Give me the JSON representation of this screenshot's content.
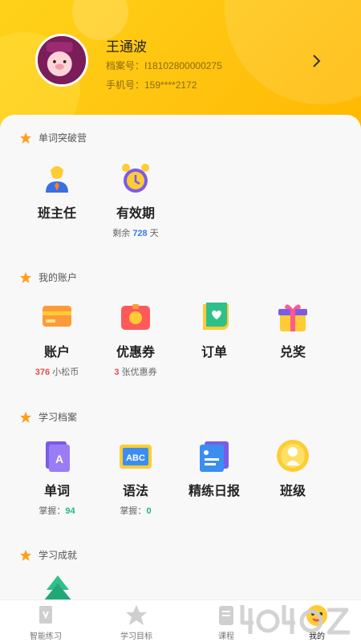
{
  "profile": {
    "name": "王通波",
    "archive_line": "档案号：I18102800000275",
    "phone_line": "手机号：159****2172"
  },
  "sections": {
    "camp": {
      "title": "单词突破营",
      "items": [
        {
          "label": "班主任"
        },
        {
          "label": "有效期",
          "sub_prefix": "剩余 ",
          "sub_value": "728",
          "sub_suffix": " 天"
        }
      ]
    },
    "account": {
      "title": "我的账户",
      "items": [
        {
          "label": "账户",
          "sub_value": "376",
          "sub_suffix": " 小松币"
        },
        {
          "label": "优惠券",
          "sub_value": "3",
          "sub_suffix": " 张优惠券"
        },
        {
          "label": "订单"
        },
        {
          "label": "兑奖"
        }
      ]
    },
    "archive": {
      "title": "学习档案",
      "items": [
        {
          "label": "单词",
          "sub_prefix": "掌握：",
          "sub_value": "94"
        },
        {
          "label": "语法",
          "sub_prefix": "掌握：",
          "sub_value": "0"
        },
        {
          "label": "精练日报"
        },
        {
          "label": "班级"
        }
      ]
    },
    "achievement": {
      "title": "学习成就"
    }
  },
  "tabbar": [
    {
      "label": "智能练习",
      "icon": "practice-icon"
    },
    {
      "label": "学习目标",
      "icon": "star-icon"
    },
    {
      "label": "课程",
      "icon": "course-icon"
    },
    {
      "label": "我的",
      "icon": "me-icon",
      "active": true
    }
  ],
  "colors": {
    "header_yellow": "#ffc20e",
    "star_orange": "#ff9f1a",
    "red_value": "#e94b4b",
    "blue_value": "#3b7bf5",
    "green_value": "#21b884"
  }
}
